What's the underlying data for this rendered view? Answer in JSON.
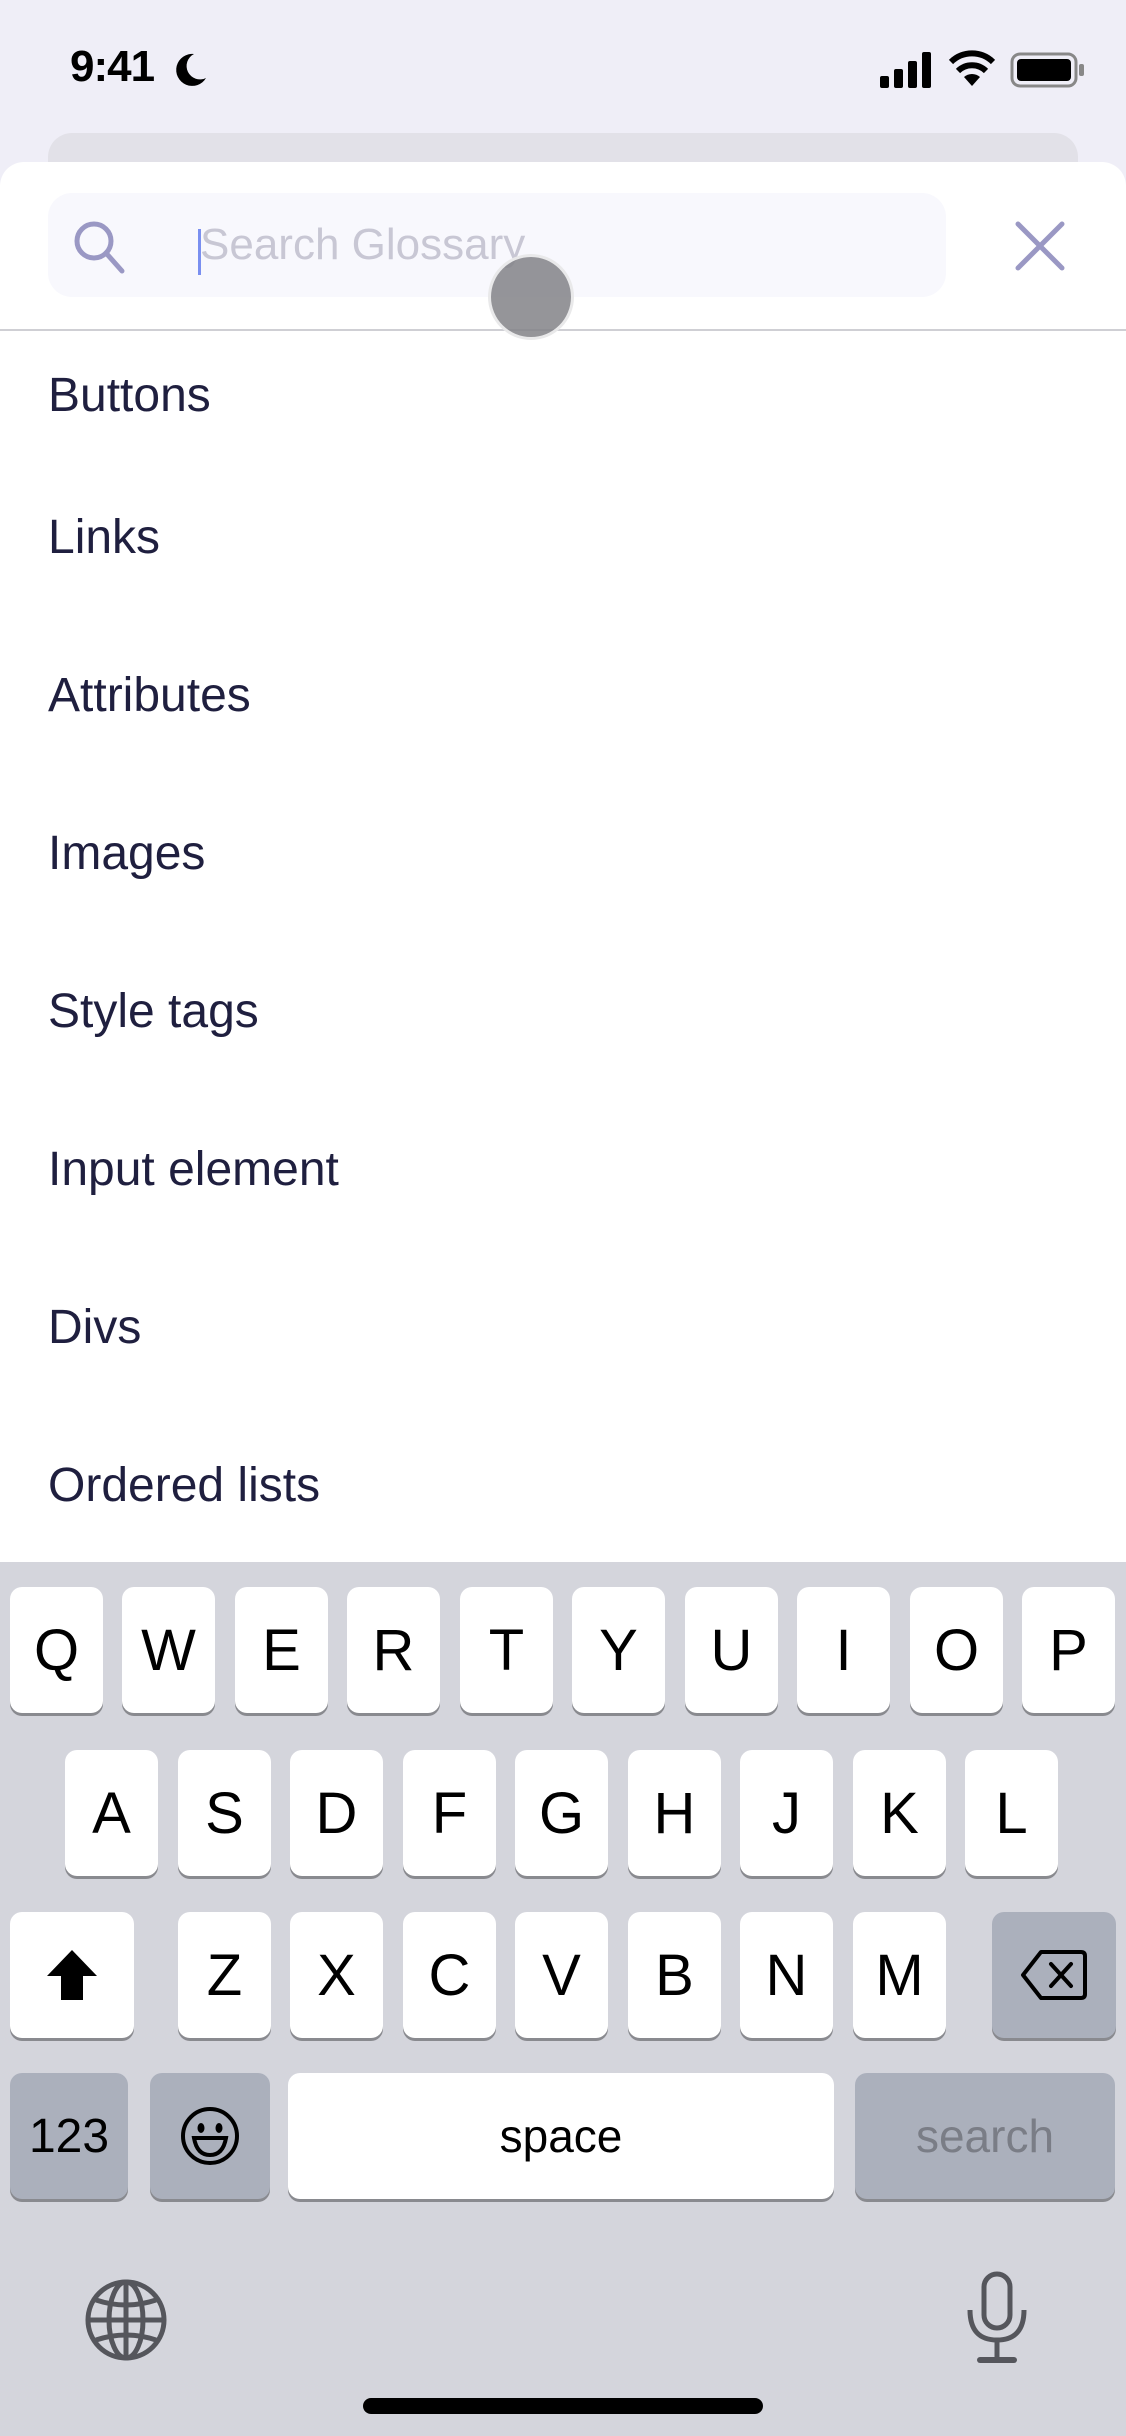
{
  "status_bar": {
    "time": "9:41",
    "focus_icon": "moon-icon",
    "signal_icon": "cellular-signal-icon",
    "wifi_icon": "wifi-icon",
    "battery_icon": "battery-icon"
  },
  "search": {
    "placeholder": "Search Glossary",
    "value": "",
    "icon": "search-icon",
    "close_icon": "close-icon"
  },
  "glossary": {
    "items": [
      {
        "label": "Buttons"
      },
      {
        "label": "Links"
      },
      {
        "label": "Attributes"
      },
      {
        "label": "Images"
      },
      {
        "label": "Style tags"
      },
      {
        "label": "Input element"
      },
      {
        "label": "Divs"
      },
      {
        "label": "Ordered lists"
      }
    ]
  },
  "keyboard": {
    "row1": [
      "Q",
      "W",
      "E",
      "R",
      "T",
      "Y",
      "U",
      "I",
      "O",
      "P"
    ],
    "row2": [
      "A",
      "S",
      "D",
      "F",
      "G",
      "H",
      "J",
      "K",
      "L"
    ],
    "row3": [
      "Z",
      "X",
      "C",
      "V",
      "B",
      "N",
      "M"
    ],
    "shift_icon": "shift-icon",
    "delete_icon": "delete-icon",
    "numbers_label": "123",
    "emoji_icon": "emoji-icon",
    "space_label": "space",
    "search_label": "search",
    "globe_icon": "globe-icon",
    "mic_icon": "microphone-icon"
  },
  "colors": {
    "list_text": "#1f1f3f",
    "placeholder": "#c8c7d4",
    "accent_icon": "#9a98c4",
    "keyboard_bg": "#d4d5dc"
  }
}
